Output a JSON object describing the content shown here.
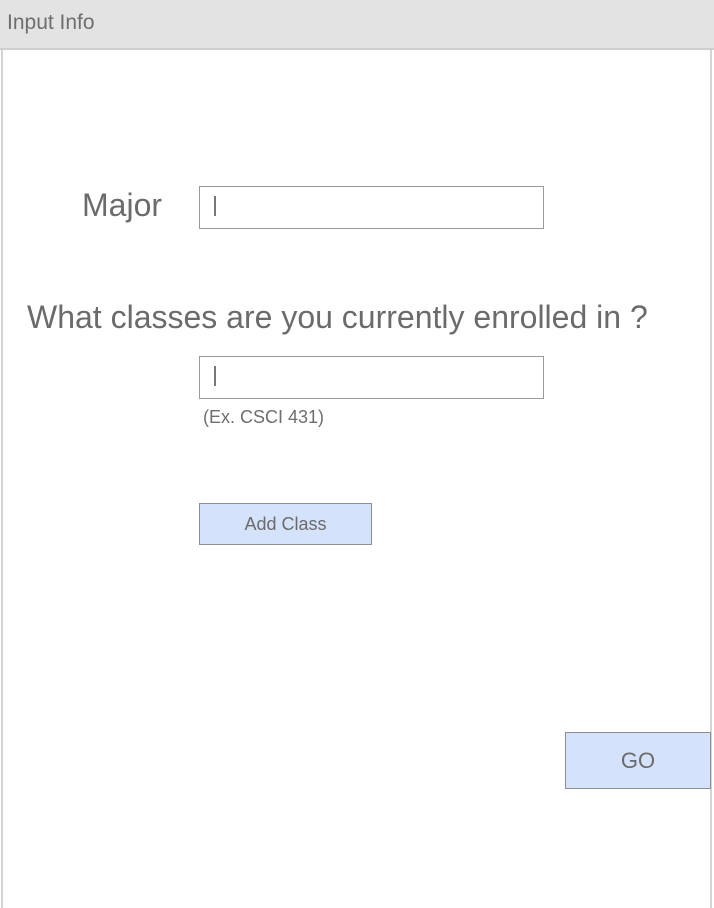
{
  "window": {
    "title": "Input Info"
  },
  "form": {
    "major_label": "Major",
    "major_value": "",
    "classes_question": "What classes are you currently enrolled in ?",
    "class_value": "",
    "class_hint": "(Ex. CSCI 431)",
    "add_class_label": "Add Class",
    "go_label": "GO"
  },
  "colors": {
    "titlebar_bg": "#e3e3e3",
    "button_bg": "#d4e3fb",
    "text": "#6b6b6b"
  }
}
